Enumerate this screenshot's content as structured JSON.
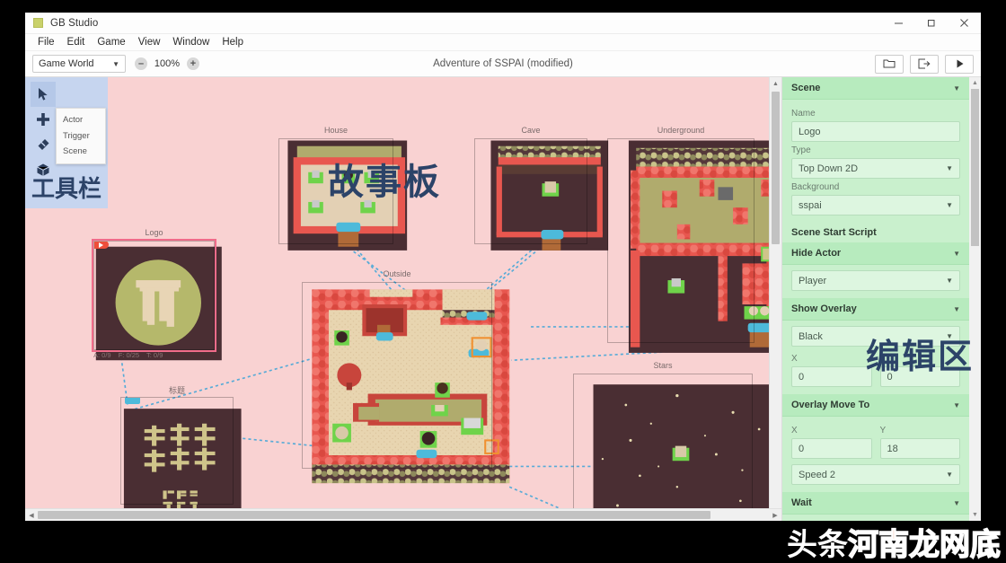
{
  "window": {
    "app_title": "GB Studio",
    "app_icon": "app-icon",
    "minimize": "–",
    "maximize": "❐",
    "close": "✕"
  },
  "menu": {
    "items": [
      {
        "label": "File"
      },
      {
        "label": "Edit"
      },
      {
        "label": "Game"
      },
      {
        "label": "View"
      },
      {
        "label": "Window"
      },
      {
        "label": "Help"
      }
    ]
  },
  "toolbar": {
    "world_select": "Game World",
    "zoom_out": "–",
    "zoom_level": "100%",
    "zoom_in": "+",
    "project_title": "Adventure of SSPAI (modified)",
    "buttons": [
      {
        "name": "open-project-folder-button",
        "icon": "folder-icon"
      },
      {
        "name": "export-button",
        "icon": "export-icon"
      },
      {
        "name": "run-button",
        "icon": "play-icon"
      }
    ]
  },
  "tool_palette": {
    "tools": [
      {
        "name": "select-tool",
        "icon": "cursor-icon",
        "selected": true
      },
      {
        "name": "add-tool",
        "icon": "plus-icon",
        "selected": false
      },
      {
        "name": "eraser-tool",
        "icon": "eraser-icon",
        "selected": false
      },
      {
        "name": "scene-tool",
        "icon": "cube-icon",
        "selected": false
      }
    ],
    "flyout": [
      {
        "label": "Actor"
      },
      {
        "label": "Trigger"
      },
      {
        "label": "Scene"
      }
    ],
    "annotation": "工具栏"
  },
  "annotations": {
    "storyboard": "故事板",
    "edit_area": "编辑区"
  },
  "scenes": [
    {
      "name": "Logo",
      "label": "Logo",
      "selected": true,
      "has_play_badge": true,
      "stats": {
        "actors": "A: 0/9",
        "frames": "F: 0/25",
        "triggers": "T: 0/9"
      }
    },
    {
      "name": "title",
      "label": "标题",
      "selected": false,
      "has_play_badge": false
    },
    {
      "name": "House",
      "label": "House",
      "selected": false,
      "has_play_badge": false
    },
    {
      "name": "Cave",
      "label": "Cave",
      "selected": false,
      "has_play_badge": false
    },
    {
      "name": "Underground",
      "label": "Underground",
      "selected": false,
      "has_play_badge": false
    },
    {
      "name": "Outside",
      "label": "Outside",
      "selected": false,
      "has_play_badge": false
    },
    {
      "name": "Stars",
      "label": "Stars",
      "selected": false,
      "has_play_badge": false
    }
  ],
  "title_scene": {
    "line1": "少数派",
    "line2": "大冒险",
    "press_start": "PRESS\nSTART"
  },
  "inspector": {
    "sections": [
      {
        "title": "Scene",
        "fields": [
          {
            "label": "Name",
            "value": "Logo",
            "type": "text"
          },
          {
            "label": "Type",
            "value": "Top Down 2D",
            "type": "select"
          },
          {
            "label": "Background",
            "value": "sspai",
            "type": "select"
          }
        ]
      },
      {
        "title": "Scene Start Script",
        "fields": []
      },
      {
        "title": "Hide Actor",
        "fields": [
          {
            "label": "",
            "value": "Player",
            "type": "select"
          }
        ]
      },
      {
        "title": "Show Overlay",
        "fields": [
          {
            "label": "",
            "value": "Black",
            "type": "select"
          },
          {
            "label": "X",
            "value": "0",
            "type": "text"
          },
          {
            "label": "Y",
            "value": "0",
            "type": "text"
          }
        ]
      },
      {
        "title": "Overlay Move To",
        "fields": [
          {
            "label": "X",
            "value": "0",
            "type": "text"
          },
          {
            "label": "Y",
            "value": "18",
            "type": "text"
          },
          {
            "label": "",
            "value": "Speed 2",
            "type": "select"
          }
        ]
      },
      {
        "title": "Wait",
        "fields": []
      }
    ]
  },
  "watermark": {
    "part1": "头条",
    "part2": "河南",
    "part3": "龙网底"
  },
  "colors": {
    "canvas_bg": "#f9d2d2",
    "panel_bg": "#c9f0cd",
    "panel_header": "#b7ebbe",
    "field_bg": "#ddf6e0",
    "toolbar_bg": "#c6d5ef",
    "annotation": "#2c4368",
    "connector": "#4aa8d8",
    "selection": "#f06c8a"
  }
}
